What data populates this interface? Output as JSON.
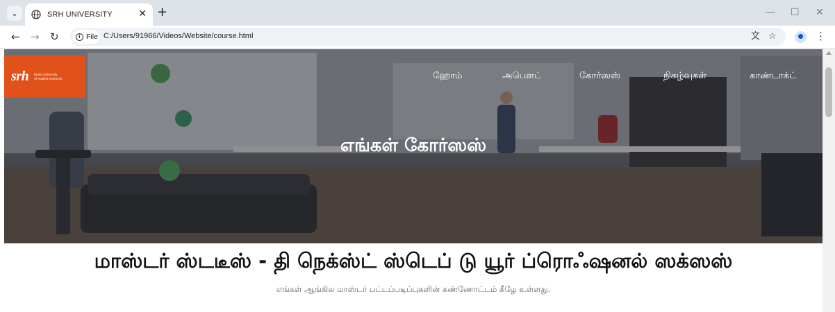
{
  "browser": {
    "tab_title": "SRH UNIVERSITY",
    "new_tab_label": "+",
    "site_chip": "File",
    "url": "C:/Users/91966/Videos/Website/course.html"
  },
  "logo": {
    "mark": "srh",
    "text_line1": "Berlin University",
    "text_line2": "of Applied Sciences"
  },
  "nav": {
    "items": [
      "ஹோம்",
      "அபௌட்",
      "கோர்ஸஸ்",
      "நிகழ்வுகள்",
      "காண்டாக்ட்"
    ]
  },
  "hero": {
    "title": "எங்கள் கோர்ஸஸ்"
  },
  "section": {
    "title": "மாஸ்டர் ஸ்டடீஸ் - தி நெக்ஸ்ட் ஸ்டெப் டு யூர் ப்ரொஃஷனல் ஸக்ஸஸ்",
    "subtitle": "எங்கள் ஆங்கில மாஸ்டர் பட்டப்படிப்புகளின் கண்ணோட்டம் கீழே உள்ளது."
  },
  "icons": {
    "tab_search": "chevron-down-icon",
    "tab_favicon": "globe-icon",
    "tab_close": "close-icon",
    "back": "arrow-left-icon",
    "forward": "arrow-right-icon",
    "reload": "reload-icon",
    "info": "info-icon",
    "translate": "translate-icon",
    "bookmark": "star-icon",
    "profile": "profile-icon",
    "menu": "kebab-menu-icon"
  },
  "colors": {
    "brand_orange": "#e0521a",
    "chrome_bg": "#dee3ea",
    "text_dark": "#111111",
    "text_muted": "#666666"
  }
}
